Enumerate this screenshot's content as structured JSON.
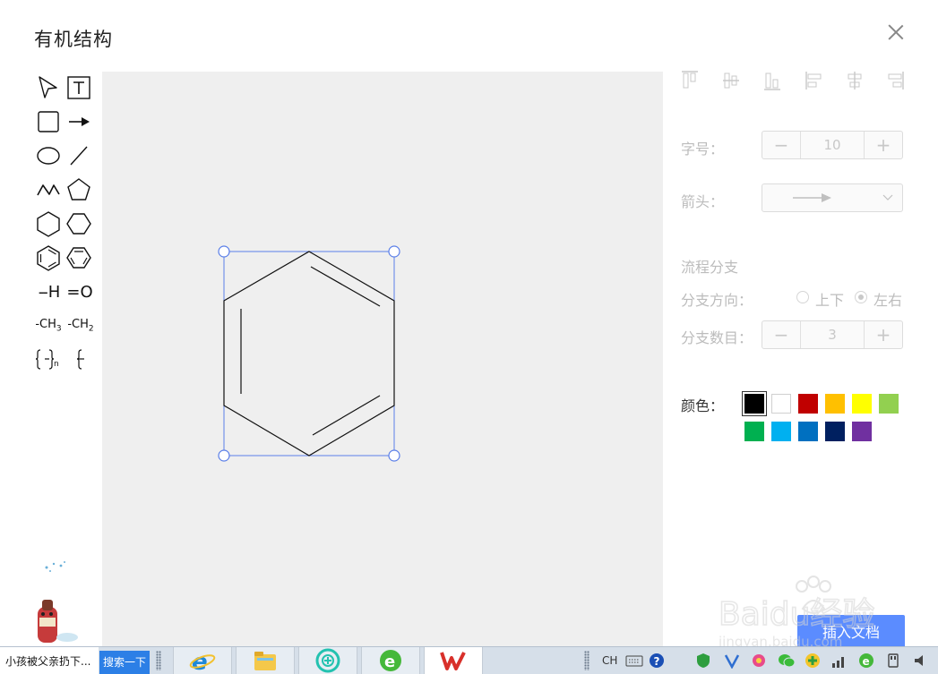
{
  "dialog": {
    "title": "有机结构",
    "close_icon": "close-icon"
  },
  "toolbar": {
    "tools": [
      {
        "id": "select",
        "icon": "pointer-icon"
      },
      {
        "id": "text",
        "icon": "text-icon"
      },
      {
        "id": "rectangle",
        "icon": "rectangle-icon"
      },
      {
        "id": "arrow",
        "icon": "arrow-icon"
      },
      {
        "id": "ellipse",
        "icon": "ellipse-icon"
      },
      {
        "id": "line",
        "icon": "line-icon"
      },
      {
        "id": "zigzag",
        "icon": "zigzag-icon"
      },
      {
        "id": "pentagon",
        "icon": "pentagon-icon"
      },
      {
        "id": "hexagon-vertical",
        "icon": "hexagon-icon"
      },
      {
        "id": "hexagon-horizontal",
        "icon": "hexagon-flat-icon"
      },
      {
        "id": "benzene-vertical",
        "icon": "benzene-icon"
      },
      {
        "id": "benzene-horizontal",
        "icon": "benzene-flat-icon"
      }
    ],
    "text_tools": {
      "hydrogen": "-H",
      "carbonyl": "=O",
      "methyl_prefix": "-CH",
      "methyl_sub": "3",
      "methylene_prefix": "-CH",
      "methylene_sub": "2",
      "repeat_sub": "n"
    }
  },
  "panel": {
    "font_size_label": "字号：",
    "font_size_value": "10",
    "arrow_label": "箭头：",
    "flow_branch_title": "流程分支",
    "branch_direction_label": "分支方向：",
    "direction_options": [
      "上下",
      "左右"
    ],
    "direction_selected": "左右",
    "branch_count_label": "分支数目：",
    "branch_count_value": "3",
    "color_label": "颜色：",
    "colors": [
      "#000000",
      "#ffffff",
      "#c00000",
      "#ffc000",
      "#ffff00",
      "#92d050",
      "#00b050",
      "#00b0f0",
      "#0070c0",
      "#002060",
      "#7030a0"
    ],
    "selected_color": "#000000",
    "insert_label": "插入文档"
  },
  "taskbar": {
    "news_text": "小孩被父亲扔下...",
    "search_label": "搜索一下",
    "apps": [
      "ie-icon",
      "file-explorer-icon",
      "browser-plus-icon",
      "green-browser-icon",
      "wps-icon"
    ],
    "lang": "CH"
  },
  "watermark": {
    "brand": "Baidu经验",
    "url": "jingyan.baidu.com"
  }
}
